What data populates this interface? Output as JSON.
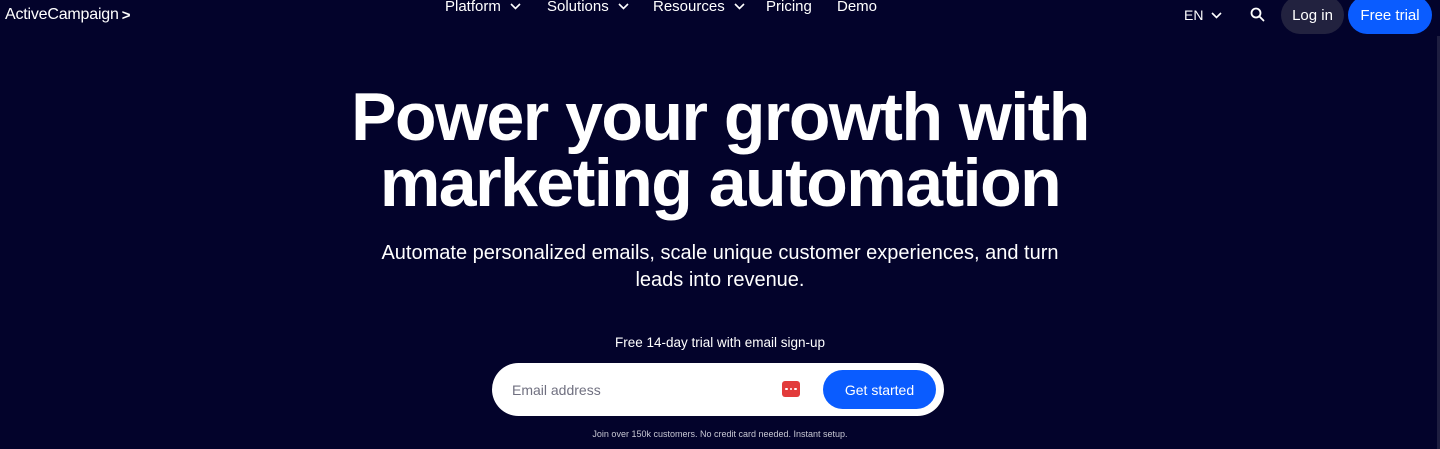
{
  "nav": {
    "logo_text": "ActiveCampaign",
    "logo_mark": ">",
    "items": [
      {
        "label": "Platform",
        "has_dropdown": true
      },
      {
        "label": "Solutions",
        "has_dropdown": true
      },
      {
        "label": "Resources",
        "has_dropdown": true
      },
      {
        "label": "Pricing",
        "has_dropdown": false
      },
      {
        "label": "Demo",
        "has_dropdown": false
      }
    ],
    "language": "EN",
    "search_icon": "search-icon",
    "login_label": "Log in",
    "free_trial_label": "Free trial"
  },
  "hero": {
    "headline_line1": "Power your growth with",
    "headline_line2": "marketing automation",
    "subhead_line1": "Automate personalized emails, scale unique customer experiences, and turn",
    "subhead_line2": "leads into revenue.",
    "trial_note": "Free 14-day trial with email sign-up",
    "email_placeholder": "Email address",
    "email_value": "",
    "password_manager_icon": "password-manager-icon",
    "cta_label": "Get started",
    "fine_print": "Join over 150k customers. No credit card needed. Instant setup."
  },
  "colors": {
    "background": "#03032b",
    "accent": "#0a5cff",
    "login_bg": "#22223f",
    "text": "#ffffff"
  }
}
